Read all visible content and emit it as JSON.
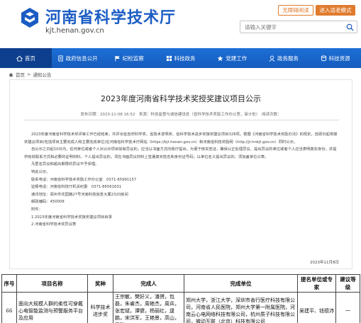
{
  "header": {
    "site_title": "河南省科学技术厅",
    "site_domain": "kjt.henan.gov.cn",
    "btn_access": "无障碍阅读",
    "btn_elder": "进入适老模式",
    "search_placeholder": "请输入关键字"
  },
  "nav": {
    "items": [
      {
        "label": "首页",
        "icon": "home-icon"
      },
      {
        "label": "政府信息公开",
        "icon": "document-icon"
      },
      {
        "label": "纪检监察",
        "icon": "flag-icon"
      },
      {
        "label": "科技政务",
        "icon": "grid-icon"
      },
      {
        "label": "党建工作",
        "icon": "star-icon"
      },
      {
        "label": "政务服务",
        "icon": "service-icon"
      },
      {
        "label": "科技资源",
        "icon": "resource-icon"
      }
    ]
  },
  "breadcrumb": {
    "home": "首页",
    "sep": ">",
    "current": "通知公告"
  },
  "article": {
    "title": "2023年度河南省科学技术奖授奖建议项目公示",
    "meta": "发布日期：2023-11-08 16:52　来源：科技监督与诚信建设处（省科学技术奖励工作办公室，审计处）　阅读次数：",
    "p1": "2023年度河南省科学技术奖评审工作已经结束，共评出省自然科学奖、省技术发明奖、省科学技术进步奖授奖建议项目328项。根据《河南省科学技术奖励办法》的规定，自即日起将授奖建议项目(包括项目主要完成人和主要完成单位)在河南省科学技术厅网站（https://kjt.henan.gov.cn）和河南省科技奖励网（http://jr.hnkjt.gov.cn）同时公示。",
    "p2": "自公示之日起10日内，任何单位或者个人对公示项目如有异议的，应当以书面方式向我厅提出，为便于核实查证，确保公正处理异议，提出异议的单位或者个人应当表明真实身份，并提供有效联系方式和必要的证明材料。个人提出异议的，须在书面异议材料上签署真实姓名和身份证号码；以单位名义提出异议的，须加盖单位公章。",
    "p3": "凡匿名异议和超出期限的异议不予受理。",
    "p4": "特此公示。",
    "contact1": "联系电话：河南省科学技术奖励工作办公室　0371-65991157",
    "contact2": "监督电话：河南省科技厅机关纪委　0371-86561631",
    "contact3": "通讯地址：郑州市花园路27号河南科技信息大厦2320房间",
    "contact4": "邮政编码：450008",
    "attach_label": "附件：",
    "attach1": "1.2023年度河南省科学技术奖授奖建议项目目录",
    "attach2": "2.河南省科学技术奖异议表",
    "date": "2023年11月8日"
  },
  "table": {
    "headers": [
      "序号",
      "项目名称",
      "奖种",
      "完成人",
      "完成单位",
      "提名单位或专家",
      "建议等级"
    ],
    "rows": [
      {
        "no": "66",
        "name": "面向大规模人群的柔性可穿戴心电智能监测与预警服务平台及应用",
        "award": "科学技术进步奖",
        "people": "王宗敏，樊好义，潘赟，包磊，朱睿杰，周艳杰，周兵，张宏斌，谭健，杨丽红，逯鹏，宋洪军，王艳景，高山，吴瑛",
        "units": "郑州大学，浙江大学，深圳市善行医疗科技有限公司，河南省人民医院，郑州大学第一附属医院，河南云心电网络科技有限公司，杭州质子科技有限公司，微动互联（北京）科技有限公司",
        "nominator": "吴建平、钱德沛",
        "level": "一"
      }
    ]
  },
  "colors": {
    "brand_blue": "#1b5cc4",
    "nav_blue": "#1d6fd6",
    "nav_active": "#0d3f8e",
    "orange": "#e07b2e"
  }
}
